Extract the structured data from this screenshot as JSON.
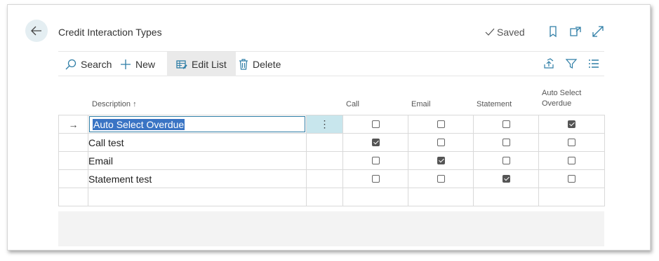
{
  "page": {
    "title": "Credit Interaction Types",
    "saved_label": "Saved"
  },
  "toolbar": {
    "search_label": "Search",
    "new_label": "New",
    "edit_list_label": "Edit List",
    "delete_label": "Delete"
  },
  "grid": {
    "columns": {
      "description": "Description",
      "sort_indicator": "↑",
      "call": "Call",
      "email": "Email",
      "statement": "Statement",
      "auto_select_line1": "Auto Select",
      "auto_select_line2": "Overdue"
    },
    "rows": [
      {
        "description": "Auto Select Overdue",
        "call": false,
        "email": false,
        "statement": false,
        "auto_select_overdue": true,
        "selected": true
      },
      {
        "description": "Call test",
        "call": true,
        "email": false,
        "statement": false,
        "auto_select_overdue": false
      },
      {
        "description": "Email",
        "call": false,
        "email": true,
        "statement": false,
        "auto_select_overdue": false
      },
      {
        "description": "Statement test",
        "call": false,
        "email": false,
        "statement": true,
        "auto_select_overdue": false
      }
    ],
    "row_menu_glyph": "⋮",
    "current_row_glyph": "→"
  },
  "icons": {
    "back": "arrow-left-icon",
    "saved": "checkmark-icon",
    "bookmark": "bookmark-icon",
    "popout": "open-in-new-window-icon",
    "expand": "expand-icon",
    "search": "search-icon",
    "new": "plus-icon",
    "edit_list": "edit-list-icon",
    "delete": "trash-icon",
    "share": "share-icon",
    "filter": "filter-icon",
    "list": "list-icon"
  },
  "colors": {
    "accent": "#2f7ea6",
    "selection": "#3a74c4",
    "row_menu_bg": "#c8e6ed",
    "back_btn_bg": "#e4eef2"
  }
}
